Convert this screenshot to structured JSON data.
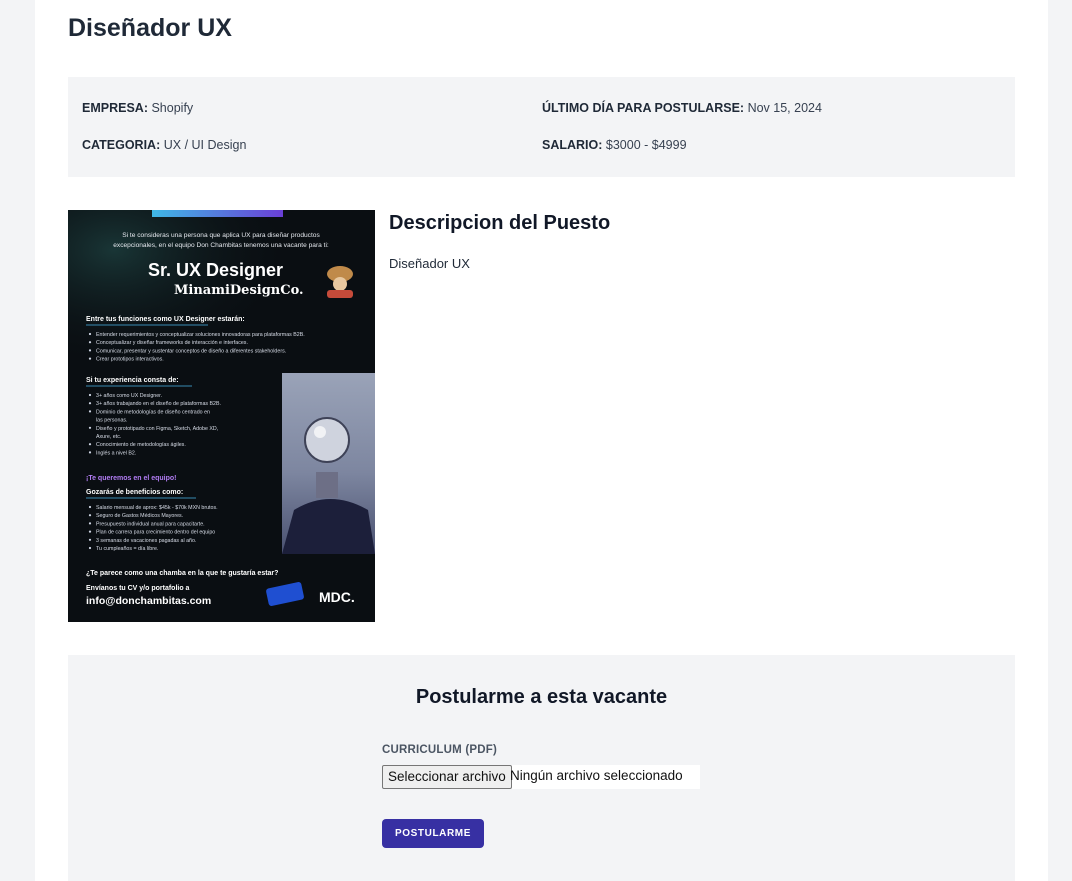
{
  "job": {
    "title": "Diseñador UX",
    "empresa_label": "EMPRESA:",
    "empresa": "Shopify",
    "deadline_label": "ÚLTIMO DÍA PARA POSTULARSE:",
    "deadline": "Nov 15, 2024",
    "categoria_label": "CATEGORIA:",
    "categoria": "UX / UI Design",
    "salario_label": "SALARIO:",
    "salario": "$3000 - $4999"
  },
  "description": {
    "heading": "Descripcion del Puesto",
    "text": "Diseñador UX"
  },
  "poster": {
    "intro1": "Si te consideras una persona que aplica UX para diseñar productos",
    "intro2": "excepcionales, en el equipo Don Chambitas tenemos una vacante para ti:",
    "role": "Sr. UX Designer",
    "company": "MinamiDesignCo.",
    "functions_title": "Entre tus funciones como UX Designer estarán:",
    "functions": [
      "Entender requerimientos y conceptualizar soluciones innovadoras para plataformas B2B.",
      "Conceptualizar y diseñar frameworks de interacción e interfaces.",
      "Comunicar, presentar y sustentar conceptos de diseño a diferentes stakeholders.",
      "Crear prototipos interactivos."
    ],
    "experience_title": "Si tu experiencia consta de:",
    "experience": [
      "3+ años como UX Designer.",
      "3+ años trabajando en el diseño de plataformas B2B.",
      "Dominio de metodologías de diseño centrado en",
      "las personas.",
      "Diseño y prototipado con Figma, Sketch, Adobe XD,",
      "Axure, etc.",
      "Conocimiento de metodologías ágiles.",
      "Inglés a nivel B2."
    ],
    "team_line": "¡Te queremos en el equipo!",
    "benefits_title": "Gozarás de beneficios como:",
    "benefits": [
      "Salario mensual de aprox: $45k - $70k MXN brutos.",
      "Seguro de Gastos Médicos Mayores.",
      "Presupuesto individual anual para capacitarte.",
      "Plan de carrera para crecimiento dentro del equipo",
      "3 semanas de vacaciones pagadas al año.",
      "Tu cumpleaños = día libre."
    ],
    "question": "¿Te parece como una chamba en la que te gustaría estar?",
    "send_line": "Envíanos tu CV y/o portafolio a",
    "email": "info@donchambitas.com",
    "mdc": "MDC."
  },
  "apply": {
    "heading": "Postularme a esta vacante",
    "cv_label": "CURRICULUM (PDF)",
    "file_button": "Seleccionar archivo",
    "file_status": "Ningún archivo seleccionado",
    "submit": "POSTULARME"
  },
  "colors": {
    "page_bg": "#f3f4f6",
    "card_bg": "#ffffff",
    "panel_bg": "#f3f4f6",
    "primary": "#3730a3",
    "poster_accent": "#49b3e8"
  }
}
